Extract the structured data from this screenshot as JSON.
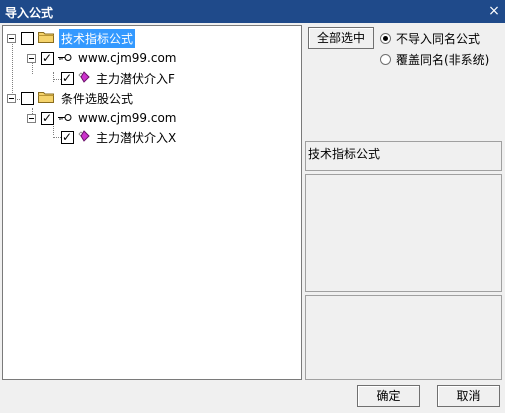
{
  "window": {
    "title": "导入公式",
    "close_glyph": "×"
  },
  "tree": {
    "nodes": [
      {
        "label": "技术指标公式",
        "checked": false,
        "selected": true
      },
      {
        "label": "www.cjm99.com",
        "checked": true
      },
      {
        "label": "主力潜伏介入F",
        "checked": true
      },
      {
        "label": "条件选股公式",
        "checked": false
      },
      {
        "label": "www.cjm99.com",
        "checked": true
      },
      {
        "label": "主力潜伏介入X",
        "checked": true
      }
    ]
  },
  "options": {
    "select_all_label": "全部选中",
    "radio": [
      {
        "label": "不导入同名公式",
        "selected": true
      },
      {
        "label": "覆盖同名(非系统)",
        "selected": false
      }
    ]
  },
  "info": {
    "category_label": "技术指标公式"
  },
  "footer": {
    "ok_label": "确定",
    "cancel_label": "取消"
  },
  "colors": {
    "titlebar": "#1f4a8a",
    "selection": "#3399ff",
    "folder": "#f5d36b",
    "gem": "#cc33cc"
  }
}
